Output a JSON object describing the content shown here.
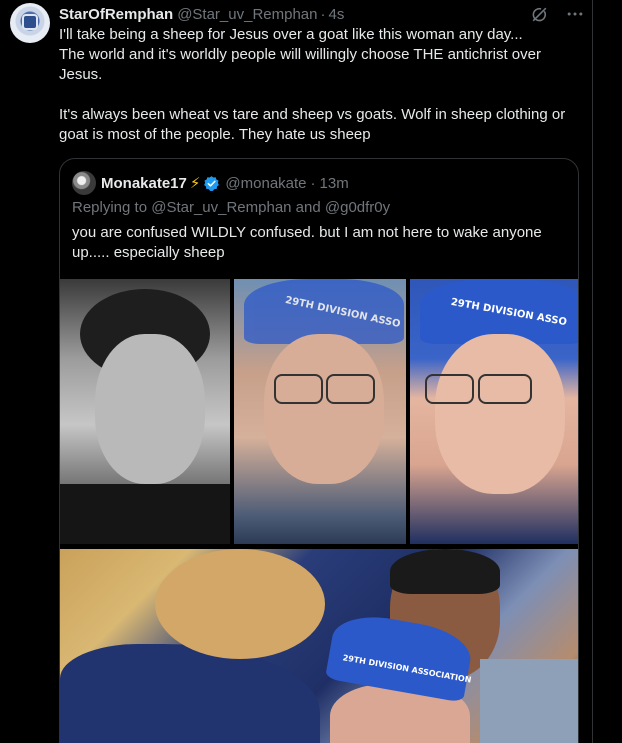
{
  "post": {
    "author_name": "StarOfRemphan",
    "author_handle": "@Star_uv_Remphan",
    "separator": "·",
    "time": "4s",
    "text_lines": [
      "I'll take being a sheep for Jesus over a goat like this woman any day...",
      "The world and it's worldly people will willingly choose THE antichrist over",
      "Jesus.",
      "",
      "It's always been wheat vs tare and sheep vs goats. Wolf in sheep clothing or",
      "goat is most of the people. They hate us sheep"
    ],
    "icons": {
      "grok": "grok-icon",
      "more": "more-icon"
    }
  },
  "quote": {
    "author_name": "Monakate17",
    "emoji": "⚡",
    "author_handle": "@monakate",
    "separator": "·",
    "time": "13m",
    "replying_to": "Replying to @Star_uv_Remphan and @g0dfr0y",
    "text_lines": [
      "you are confused WILDLY confused. but I am not here to wake anyone",
      "up..... especially sheep"
    ],
    "media": {
      "cap_text_1": "29TH DIVISION ASSO",
      "cap_text_2": "29TH DIVISION ASSO",
      "cap_text_3": "29TH DIVISION ASSOCIATION"
    },
    "verified_color": "#1d9bf0"
  }
}
